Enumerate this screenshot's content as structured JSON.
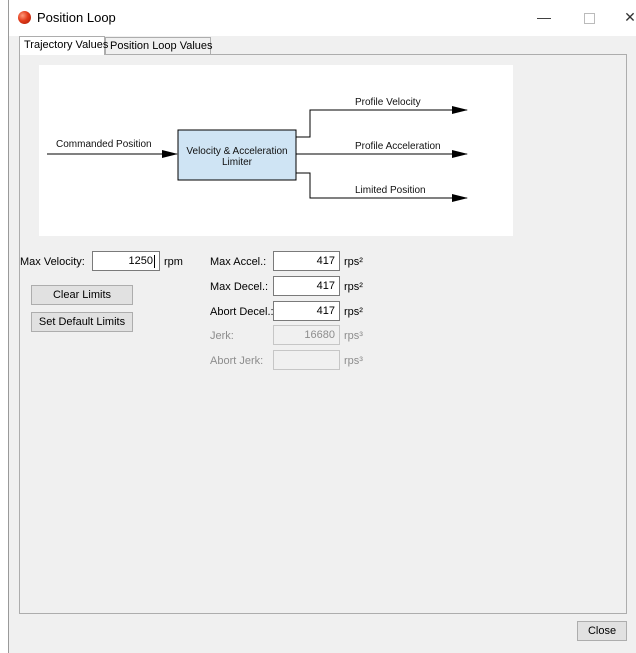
{
  "window": {
    "title": "Position Loop",
    "controls": {
      "minimize": "—",
      "close": "✕"
    }
  },
  "tabs": [
    {
      "label": "Trajectory Values",
      "active": true
    },
    {
      "label": "Position Loop Values",
      "active": false
    }
  ],
  "diagram": {
    "input_label": "Commanded Position",
    "block_label_line1": "Velocity & Acceleration",
    "block_label_line2": "Limiter",
    "outputs": [
      "Profile Velocity",
      "Profile Acceleration",
      "Limited Position"
    ]
  },
  "max_velocity": {
    "label": "Max Velocity:",
    "value": "1250",
    "unit": "rpm"
  },
  "buttons": {
    "clear_limits": "Clear Limits",
    "set_default_limits": "Set Default Limits",
    "close": "Close"
  },
  "limits": [
    {
      "label": "Max Accel.:",
      "value": "417",
      "unit": "rps²",
      "enabled": true
    },
    {
      "label": "Max Decel.:",
      "value": "417",
      "unit": "rps²",
      "enabled": true
    },
    {
      "label": "Abort Decel.:",
      "value": "417",
      "unit": "rps²",
      "enabled": true
    },
    {
      "label": "Jerk:",
      "value": "16680",
      "unit": "rps³",
      "enabled": false
    },
    {
      "label": "Abort Jerk:",
      "value": "",
      "unit": "rps³",
      "enabled": false
    }
  ]
}
